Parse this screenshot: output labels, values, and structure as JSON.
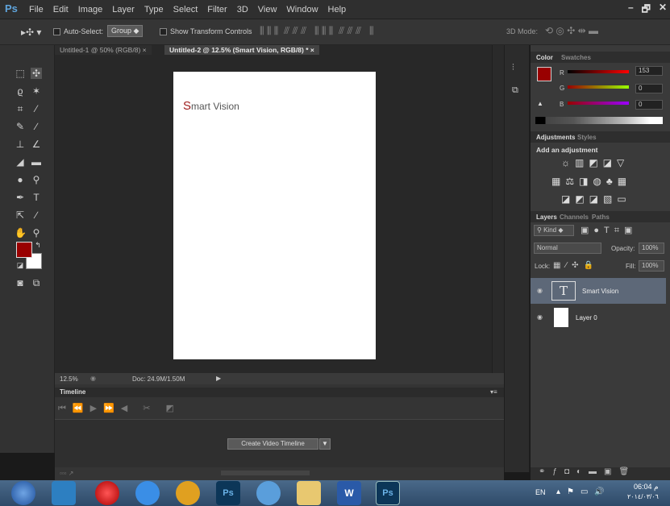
{
  "app": {
    "logo": "Ps",
    "menu": [
      "File",
      "Edit",
      "Image",
      "Layer",
      "Type",
      "Select",
      "Filter",
      "3D",
      "View",
      "Window",
      "Help"
    ],
    "window_buttons": [
      "–",
      "🗗",
      "✕"
    ]
  },
  "options": {
    "auto_select_label": "Auto-Select:",
    "group_value": "Group",
    "show_transform_label": "Show Transform Controls",
    "mode_label": "3D Mode:"
  },
  "tabs": [
    {
      "label": "Untitled-1 @ 50% (RGB/8)",
      "close": "×"
    },
    {
      "label": "Untitled-2 @ 12.5% (Smart Vision, RGB/8) *",
      "close": "×"
    }
  ],
  "document": {
    "text_first": "S",
    "text_rest": "mart Vision"
  },
  "status": {
    "zoom": "12.5%",
    "doc": "Doc: 24.9M/1.50M"
  },
  "timeline": {
    "title": "Timeline",
    "create_button": "Create Video Timeline"
  },
  "color_panel": {
    "tabs": [
      "Color",
      "Swatches"
    ],
    "r_label": "R",
    "g_label": "G",
    "b_label": "B",
    "r": "153",
    "g": "0",
    "b": "0"
  },
  "adjust_panel": {
    "tabs": [
      "Adjustments",
      "Styles"
    ],
    "heading": "Add an adjustment"
  },
  "layers_panel": {
    "tabs": [
      "Layers",
      "Channels",
      "Paths"
    ],
    "kind": "Kind",
    "blend": "Normal",
    "opacity_label": "Opacity:",
    "opacity": "100%",
    "lock_label": "Lock:",
    "fill_label": "Fill:",
    "fill": "100%",
    "layers": [
      {
        "name": "Smart Vision",
        "type": "T"
      },
      {
        "name": "Layer 0",
        "type": "raster"
      }
    ]
  },
  "taskbar": {
    "lang": "EN",
    "time": "06:04 م",
    "date": "٢٠١٤/٠٣/٠٦"
  },
  "colors": {
    "fg": "#990000",
    "bg": "#ffffff",
    "accent": "#5fa4dc"
  }
}
